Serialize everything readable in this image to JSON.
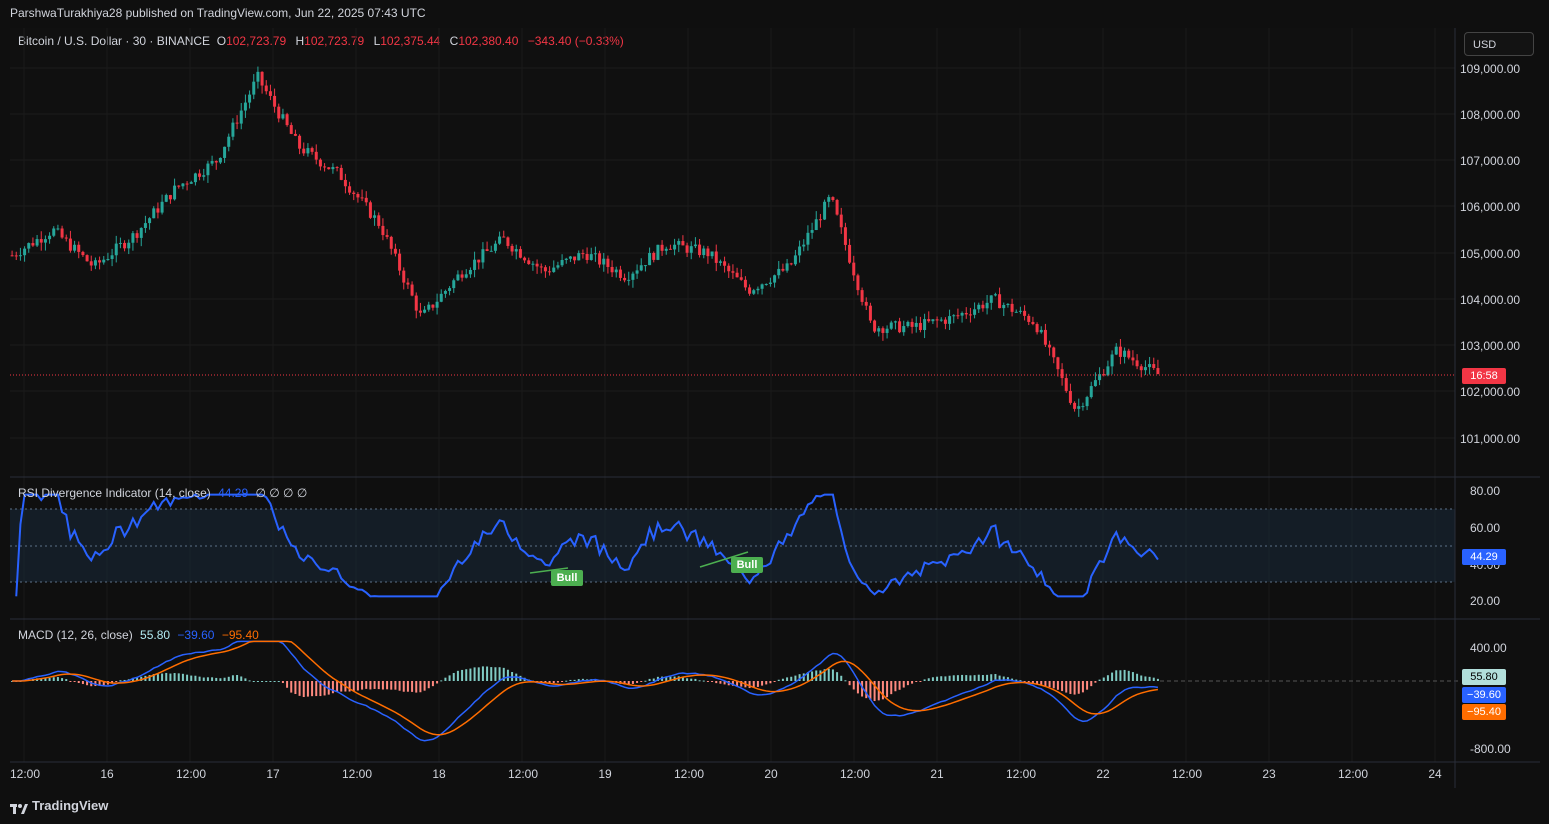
{
  "header": {
    "published_by": "ParshwaTurakhiya28 published on TradingView.com, Jun 22, 2025 07:43 UTC"
  },
  "symbol": {
    "name": "Bitcoin / U.S. Dollar · 30 · BINANCE",
    "o_label": "O",
    "o": "102,723.79",
    "h_label": "H",
    "h": "102,723.79",
    "l_label": "L",
    "l": "102,375.44",
    "c_label": "C",
    "c": "102,380.40",
    "change": "−343.40 (−0.33%)"
  },
  "currency_button": "USD",
  "countdown": "16:58",
  "colors": {
    "up": "#26a69a",
    "down": "#f23645",
    "rsi": "#2962ff",
    "signal": "#ff6d00",
    "bull": "#4caf50"
  },
  "price_axis": [
    "109,000.00",
    "108,000.00",
    "107,000.00",
    "106,000.00",
    "105,000.00",
    "104,000.00",
    "103,000.00",
    "102,000.00",
    "101,000.00"
  ],
  "rsi": {
    "title": "RSI Divergence Indicator (14, close)",
    "value": "44.29",
    "extras": "∅ ∅ ∅ ∅",
    "axis": [
      "80.00",
      "60.00",
      "40.00",
      "20.00"
    ],
    "bull_label": "Bull"
  },
  "macd": {
    "title": "MACD (12, 26, close)",
    "hist": "55.80",
    "macd": "−39.60",
    "signal": "−95.40",
    "axis": [
      "400.00",
      "-800.00"
    ]
  },
  "time_axis": [
    "12:00",
    "16",
    "12:00",
    "17",
    "12:00",
    "18",
    "12:00",
    "19",
    "12:00",
    "20",
    "12:00",
    "21",
    "12:00",
    "22",
    "12:00",
    "23",
    "12:00",
    "24"
  ],
  "footer": {
    "brand": "TradingView"
  },
  "chart_data": {
    "type": "line",
    "title": "Bitcoin / U.S. Dollar · 30 · BINANCE",
    "xlabel": "",
    "ylabel": "",
    "x": [
      "Jun 15 12:00",
      "Jun 15 18:00",
      "Jun 16 00:00",
      "Jun 16 06:00",
      "Jun 16 12:00",
      "Jun 16 18:00",
      "Jun 16 22:00",
      "Jun 17 02:00",
      "Jun 17 06:00",
      "Jun 17 12:00",
      "Jun 17 18:00",
      "Jun 18 00:00",
      "Jun 18 06:00",
      "Jun 18 12:00",
      "Jun 18 18:00",
      "Jun 19 00:00",
      "Jun 19 06:00",
      "Jun 19 12:00",
      "Jun 19 18:00",
      "Jun 20 00:00",
      "Jun 20 06:00",
      "Jun 20 12:00",
      "Jun 20 18:00",
      "Jun 21 00:00",
      "Jun 21 06:00",
      "Jun 21 12:00",
      "Jun 21 18:00",
      "Jun 22 00:00",
      "Jun 22 06:00"
    ],
    "ylim": [
      100500,
      109500
    ],
    "series": [
      {
        "values": [
          104950,
          105500,
          104700,
          105400,
          106400,
          107000,
          108800,
          107300,
          106700,
          105600,
          103600,
          104600,
          105300,
          104600,
          105000,
          104500,
          105200,
          105000,
          104200,
          104700,
          106200,
          103400,
          103400,
          103600,
          104000,
          103500,
          101600,
          102900,
          102380
        ]
      }
    ]
  }
}
